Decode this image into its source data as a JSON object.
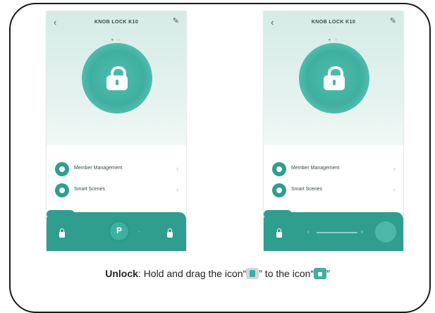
{
  "screens": [
    {
      "title": "KNOB LOCK K10",
      "pager": "●  ○",
      "menu": [
        {
          "label": "Member Management"
        },
        {
          "label": "Smart Scenes"
        }
      ],
      "knob_label": "P",
      "track_dot": "·"
    },
    {
      "title": "KNOB LOCK K10",
      "pager": "●  ○",
      "menu": [
        {
          "label": "Member Management"
        },
        {
          "label": "Smart Scenes"
        }
      ],
      "track_left": "‹",
      "track_right": "›"
    }
  ],
  "caption": {
    "bold": "Unlock",
    "text1": ": Hold and drag the icon“",
    "text2": "” to the icon“",
    "text3": "”"
  },
  "icons": [
    "back-icon",
    "edit-icon",
    "padlock-icon",
    "member-icon",
    "scenes-icon",
    "lock-icon",
    "unlock-icon"
  ],
  "colors": {
    "accent": "#2f9e8e",
    "blob": "#45b5a6",
    "header_bg": "#dcefeb"
  }
}
